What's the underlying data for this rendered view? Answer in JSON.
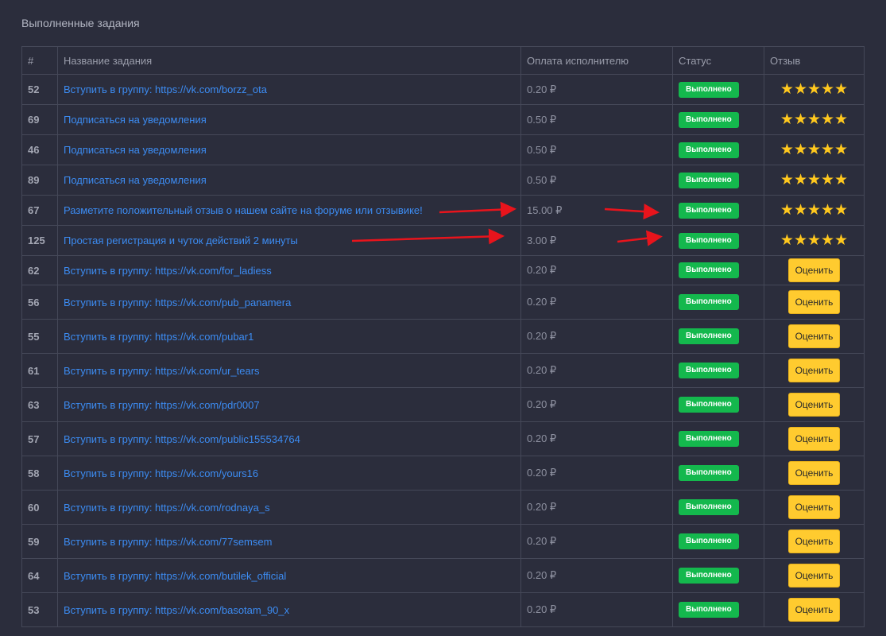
{
  "section_title": "Выполненные задания",
  "columns": {
    "num": "#",
    "name": "Название задания",
    "pay": "Оплата исполнителю",
    "status": "Статус",
    "review": "Отзыв"
  },
  "rows": [
    {
      "num": "52",
      "name": "Вступить в группу: https://vk.com/borzz_ota",
      "pay": "0.20 ₽",
      "status": "Выполнено",
      "review": "stars",
      "stars": "★★★★★",
      "rating": 5
    },
    {
      "num": "69",
      "name": "Подписаться на уведомления",
      "pay": "0.50 ₽",
      "status": "Выполнено",
      "review": "stars",
      "stars": "★★★★★",
      "rating": 5
    },
    {
      "num": "46",
      "name": "Подписаться на уведомления",
      "pay": "0.50 ₽",
      "status": "Выполнено",
      "review": "stars",
      "stars": "★★★★★",
      "rating": 5
    },
    {
      "num": "89",
      "name": "Подписаться на уведомления",
      "pay": "0.50 ₽",
      "status": "Выполнено",
      "review": "stars",
      "stars": "★★★★★",
      "rating": 5
    },
    {
      "num": "67",
      "name": "Разметите положительный отзыв о нашем сайте на форуме или отзывике!",
      "pay": "15.00 ₽",
      "status": "Выполнено",
      "review": "stars",
      "stars": "★★★★★",
      "rating": 5
    },
    {
      "num": "125",
      "name": "Простая регистрация и чуток действий 2 минуты",
      "pay": "3.00 ₽",
      "status": "Выполнено",
      "review": "stars",
      "stars": "★★★★★",
      "rating": 5
    },
    {
      "num": "62",
      "name": "Вступить в группу: https://vk.com/for_ladiess",
      "pay": "0.20 ₽",
      "status": "Выполнено",
      "review": "button",
      "button_label": "Оценить"
    },
    {
      "num": "56",
      "name": "Вступить в группу: https://vk.com/pub_panamera",
      "pay": "0.20 ₽",
      "status": "Выполнено",
      "review": "button",
      "button_label": "Оценить"
    },
    {
      "num": "55",
      "name": "Вступить в группу: https://vk.com/pubar1",
      "pay": "0.20 ₽",
      "status": "Выполнено",
      "review": "button",
      "button_label": "Оценить"
    },
    {
      "num": "61",
      "name": "Вступить в группу: https://vk.com/ur_tears",
      "pay": "0.20 ₽",
      "status": "Выполнено",
      "review": "button",
      "button_label": "Оценить"
    },
    {
      "num": "63",
      "name": "Вступить в группу: https://vk.com/pdr0007",
      "pay": "0.20 ₽",
      "status": "Выполнено",
      "review": "button",
      "button_label": "Оценить"
    },
    {
      "num": "57",
      "name": "Вступить в группу: https://vk.com/public155534764",
      "pay": "0.20 ₽",
      "status": "Выполнено",
      "review": "button",
      "button_label": "Оценить"
    },
    {
      "num": "58",
      "name": "Вступить в группу: https://vk.com/yours16",
      "pay": "0.20 ₽",
      "status": "Выполнено",
      "review": "button",
      "button_label": "Оценить"
    },
    {
      "num": "60",
      "name": "Вступить в группу: https://vk.com/rodnaya_s",
      "pay": "0.20 ₽",
      "status": "Выполнено",
      "review": "button",
      "button_label": "Оценить"
    },
    {
      "num": "59",
      "name": "Вступить в группу: https://vk.com/77semsem",
      "pay": "0.20 ₽",
      "status": "Выполнено",
      "review": "button",
      "button_label": "Оценить"
    },
    {
      "num": "64",
      "name": "Вступить в группу: https://vk.com/butilek_official",
      "pay": "0.20 ₽",
      "status": "Выполнено",
      "review": "button",
      "button_label": "Оценить"
    },
    {
      "num": "53",
      "name": "Вступить в группу: https://vk.com/basotam_90_x",
      "pay": "0.20 ₽",
      "status": "Выполнено",
      "review": "button",
      "button_label": "Оценить"
    }
  ],
  "colors": {
    "background": "#2b2d3c",
    "link": "#3c8cf3",
    "status_green": "#14b84d",
    "star_yellow": "#ffc81e",
    "rate_button": "#ffcb2f",
    "annotation_arrow": "#e8141c"
  },
  "icons": {
    "star": "star-icon",
    "annotation": "red-arrow-annotation"
  }
}
